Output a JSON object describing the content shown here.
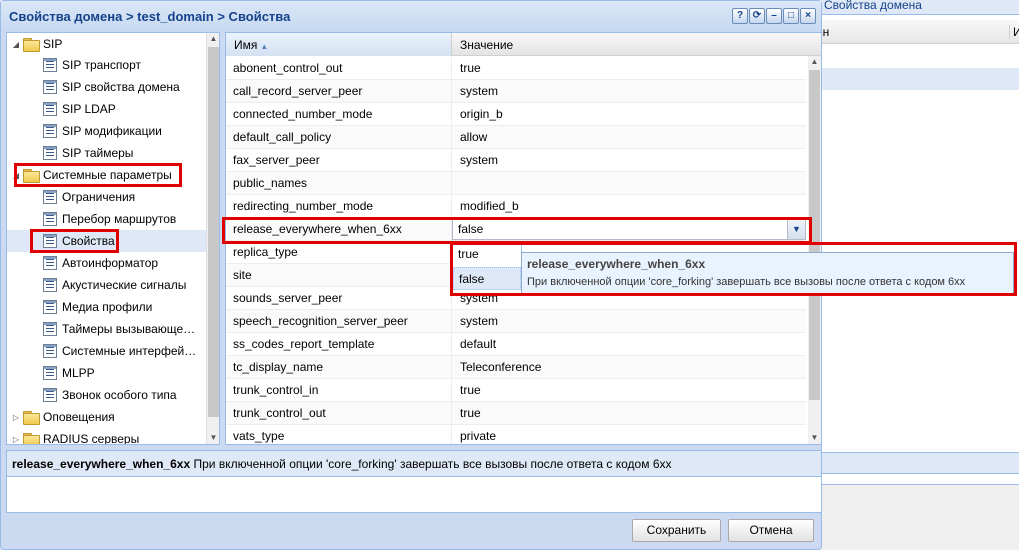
{
  "background_window": {
    "tab_title": "Свойства домена",
    "col1_header": "ен",
    "col2_header": "И"
  },
  "dialog": {
    "title": "Свойства домена > test_domain > Свойства",
    "tools": [
      {
        "name": "help-icon",
        "glyph": "?"
      },
      {
        "name": "refresh-icon",
        "glyph": "⟳"
      },
      {
        "name": "minimize-icon",
        "glyph": "–"
      },
      {
        "name": "maximize-icon",
        "glyph": "□"
      },
      {
        "name": "close-icon",
        "glyph": "×"
      }
    ]
  },
  "tree": {
    "items": [
      {
        "label": "SIP",
        "type": "folder",
        "expanded": true
      },
      {
        "label": "SIP транспорт",
        "type": "leaf"
      },
      {
        "label": "SIP свойства домена",
        "type": "leaf"
      },
      {
        "label": "SIP LDAP",
        "type": "leaf"
      },
      {
        "label": "SIP модификации",
        "type": "leaf"
      },
      {
        "label": "SIP таймеры",
        "type": "leaf"
      },
      {
        "label": "Системные параметры",
        "type": "folder",
        "expanded": true
      },
      {
        "label": "Ограничения",
        "type": "leaf"
      },
      {
        "label": "Перебор маршрутов",
        "type": "leaf"
      },
      {
        "label": "Свойства",
        "type": "leaf",
        "selected": true
      },
      {
        "label": "Автоинформатор",
        "type": "leaf"
      },
      {
        "label": "Акустические сигналы",
        "type": "leaf"
      },
      {
        "label": "Медиа профили",
        "type": "leaf"
      },
      {
        "label": "Таймеры вызывающе…",
        "type": "leaf"
      },
      {
        "label": "Системные интерфей…",
        "type": "leaf"
      },
      {
        "label": "MLPP",
        "type": "leaf"
      },
      {
        "label": "Звонок особого типа",
        "type": "leaf"
      },
      {
        "label": "Оповещения",
        "type": "folder",
        "expanded": false
      },
      {
        "label": "RADIUS серверы",
        "type": "folder",
        "expanded": false
      }
    ]
  },
  "grid": {
    "col_name": "Имя",
    "col_value": "Значение",
    "rows": [
      {
        "name": "abonent_control_out",
        "value": "true"
      },
      {
        "name": "call_record_server_peer",
        "value": "system"
      },
      {
        "name": "connected_number_mode",
        "value": "origin_b"
      },
      {
        "name": "default_call_policy",
        "value": "allow"
      },
      {
        "name": "fax_server_peer",
        "value": "system"
      },
      {
        "name": "public_names",
        "value": ""
      },
      {
        "name": "redirecting_number_mode",
        "value": "modified_b"
      },
      {
        "name": "release_everywhere_when_6xx",
        "value": "false",
        "editing": true
      },
      {
        "name": "replica_type",
        "value": ""
      },
      {
        "name": "site",
        "value": ""
      },
      {
        "name": "sounds_server_peer",
        "value": "system"
      },
      {
        "name": "speech_recognition_server_peer",
        "value": "system"
      },
      {
        "name": "ss_codes_report_template",
        "value": "default"
      },
      {
        "name": "tc_display_name",
        "value": "Teleconference"
      },
      {
        "name": "trunk_control_in",
        "value": "true"
      },
      {
        "name": "trunk_control_out",
        "value": "true"
      },
      {
        "name": "vats_type",
        "value": "private"
      }
    ],
    "dropdown_options": [
      "true",
      "false"
    ],
    "dropdown_selected": "false"
  },
  "tooltip": {
    "title": "release_everywhere_when_6xx",
    "text": "При включенной опции 'core_forking' завершать все вызовы после ответа с кодом 6хх"
  },
  "description": {
    "name": "release_everywhere_when_6xx",
    "text": "При включенной опции 'core_forking' завершать все вызовы после ответа с кодом 6хх"
  },
  "buttons": {
    "save": "Сохранить",
    "cancel": "Отмена"
  },
  "colors": {
    "title_text": "#15428b",
    "highlight": "#e00000",
    "selection": "#dfe8f6"
  }
}
